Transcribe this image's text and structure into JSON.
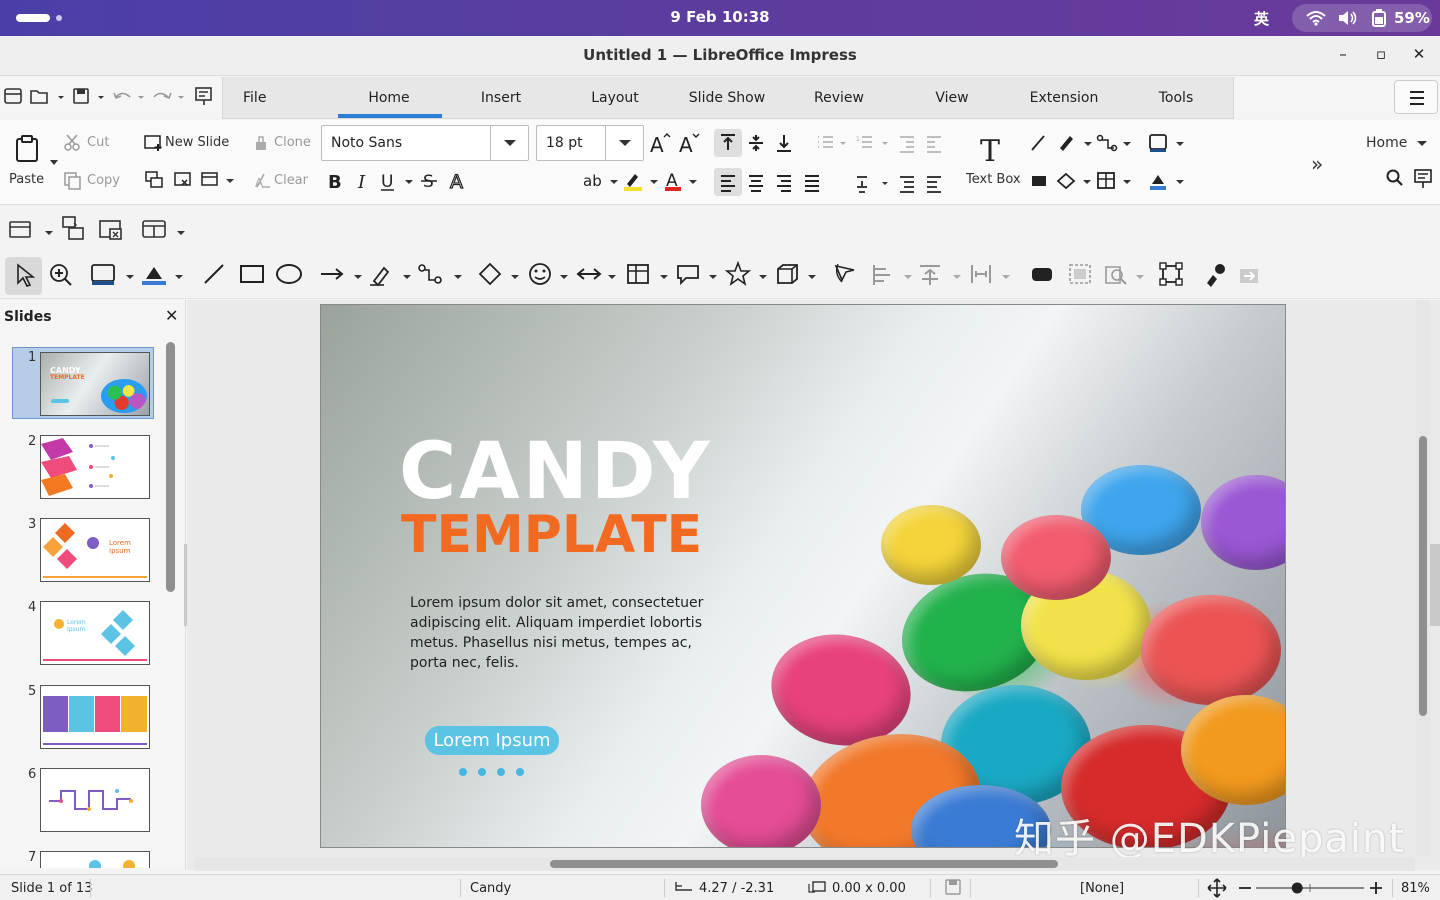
{
  "system": {
    "date_time": "9 Feb  10:38",
    "ime": "英",
    "battery": "59%"
  },
  "window": {
    "title": "Untitled 1 — LibreOffice Impress",
    "minimize": "–",
    "maximize": "▫",
    "close": "✕"
  },
  "tabs": [
    "File",
    "Home",
    "Insert",
    "Layout",
    "Slide Show",
    "Review",
    "View",
    "Extension",
    "Tools"
  ],
  "active_tab": "Home",
  "ribbon": {
    "paste": "Paste",
    "cut": "Cut",
    "copy": "Copy",
    "new_slide": "New Slide",
    "clone": "Clone",
    "clear": "Clear",
    "font_name": "Noto Sans",
    "font_size": "18 pt",
    "text_box": "Text Box",
    "home_dropdown": "Home",
    "more": "»"
  },
  "sidebar": {
    "title": "Slides",
    "close": "✕",
    "slides": [
      "1",
      "2",
      "3",
      "4",
      "5",
      "6",
      "7"
    ],
    "slide1_title": "CANDY",
    "slide1_sub": "TEMPLATE",
    "slide3_text": "Lorem Ipsum",
    "slide4_text": "Lorem Ipsum"
  },
  "slide": {
    "title": "CANDY",
    "subtitle": "TEMPLATE",
    "body": "Lorem ipsum dolor sit amet, consectetuer adipiscing elit. Aliquam imperdiet lobortis metus. Phasellus nisi metus, tempes ac, porta nec, felis.",
    "button": "Lorem Ipsum"
  },
  "watermark": "知乎 @EDKPiepaint",
  "status": {
    "slide_info": "Slide 1 of 13",
    "master": "Candy",
    "position": "4.27 / -2.31",
    "size": "0.00 x 0.00",
    "selection": "[None]",
    "zoom": "81%",
    "zoom_level": 0.81
  },
  "colors": {
    "accent": "#2a7fd4",
    "title_orange": "#f26a22",
    "button_blue": "#5bc3e4"
  }
}
